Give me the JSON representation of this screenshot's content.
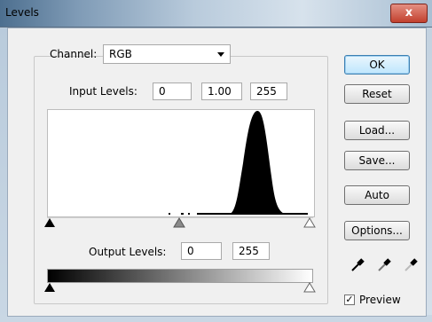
{
  "window": {
    "title": "Levels",
    "close_label": "x"
  },
  "channel": {
    "label": "Channel:",
    "value": "RGB"
  },
  "input_levels": {
    "label": "Input Levels:",
    "black": "0",
    "gamma": "1.00",
    "white": "255"
  },
  "output_levels": {
    "label": "Output Levels:",
    "black": "0",
    "white": "255"
  },
  "buttons": {
    "ok": "OK",
    "reset": "Reset",
    "load": "Load...",
    "save": "Save...",
    "auto": "Auto",
    "options": "Options..."
  },
  "preview": {
    "label": "Preview",
    "checked": true,
    "mark": "✓"
  },
  "icons": [
    "black-eyedropper-icon",
    "gray-eyedropper-icon",
    "white-eyedropper-icon"
  ]
}
